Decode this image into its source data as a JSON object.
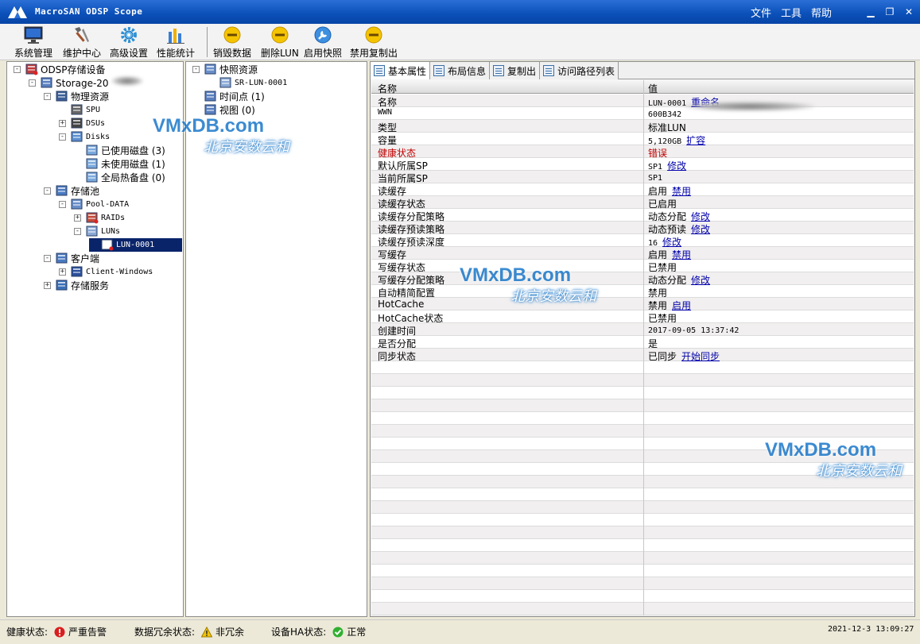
{
  "app": {
    "title": "MacroSAN ODSP Scope"
  },
  "menu": [
    "文件",
    "工具",
    "帮助"
  ],
  "window_buttons": {
    "minimize": "▁",
    "restore": "❐",
    "close": "✕"
  },
  "toolbar": [
    {
      "label": "系统管理",
      "icon": "monitor-icon"
    },
    {
      "label": "维护中心",
      "icon": "tools-icon"
    },
    {
      "label": "高级设置",
      "icon": "gear-icon"
    },
    {
      "label": "性能统计",
      "icon": "bar-chart-icon"
    },
    {
      "label": "销毁数据",
      "icon": "minus-circle-icon"
    },
    {
      "label": "删除LUN",
      "icon": "minus-circle-icon"
    },
    {
      "label": "启用快照",
      "icon": "wrench-icon"
    },
    {
      "label": "禁用复制出",
      "icon": "minus-circle-icon"
    }
  ],
  "tree": [
    {
      "label": "ODSP存储设备",
      "level": 0,
      "expander": "−",
      "icon": "storage-device-icon"
    },
    {
      "label": "Storage-20",
      "level": 1,
      "expander": "−",
      "icon": "storage-icon"
    },
    {
      "label": "物理资源",
      "level": 2,
      "expander": "−",
      "icon": "physical-resource-icon"
    },
    {
      "label": "SPU",
      "level": 3,
      "expander": "",
      "icon": "spu-icon",
      "mono": true
    },
    {
      "label": "DSUs",
      "level": 3,
      "expander": "+",
      "icon": "dsu-icon",
      "mono": true
    },
    {
      "label": "Disks",
      "level": 3,
      "expander": "−",
      "icon": "disks-icon",
      "mono": true
    },
    {
      "label": "已使用磁盘 (3)",
      "level": 4,
      "expander": "",
      "icon": "disk-icon"
    },
    {
      "label": "未使用磁盘 (1)",
      "level": 4,
      "expander": "",
      "icon": "disk-icon"
    },
    {
      "label": "全局热备盘 (0)",
      "level": 4,
      "expander": "",
      "icon": "disk-icon"
    },
    {
      "label": "存储池",
      "level": 2,
      "expander": "−",
      "icon": "pool-icon"
    },
    {
      "label": "Pool-DATA",
      "level": 3,
      "expander": "−",
      "icon": "pool-data-icon",
      "mono": true
    },
    {
      "label": "RAIDs",
      "level": 4,
      "expander": "+",
      "icon": "raid-icon",
      "mono": true
    },
    {
      "label": "LUNs",
      "level": 4,
      "expander": "−",
      "icon": "luns-icon",
      "mono": true
    },
    {
      "label": "LUN-0001",
      "level": 5,
      "expander": "",
      "icon": "lun-icon",
      "mono": true,
      "selected": true
    },
    {
      "label": "客户端",
      "level": 2,
      "expander": "−",
      "icon": "client-icon"
    },
    {
      "label": "Client-Windows",
      "level": 3,
      "expander": "+",
      "icon": "client-host-icon",
      "mono": true
    },
    {
      "label": "存储服务",
      "level": 2,
      "expander": "+",
      "icon": "service-icon"
    }
  ],
  "snap_tree": [
    {
      "label": "快照资源",
      "level": 0,
      "expander": "−",
      "icon": "snapshot-icon"
    },
    {
      "label": "SR-LUN-0001",
      "level": 1,
      "expander": "",
      "icon": "snapshot-resource-icon",
      "mono": true
    },
    {
      "label": "时间点 (1)",
      "level": 0,
      "expander": "",
      "icon": "timepoint-icon"
    },
    {
      "label": "视图 (0)",
      "level": 0,
      "expander": "",
      "icon": "view-icon"
    }
  ],
  "tabs": [
    "基本属性",
    "布局信息",
    "复制出",
    "访问路径列表"
  ],
  "grid": {
    "col_name": "名称",
    "col_value": "值",
    "rows": [
      {
        "name": "名称",
        "value": "LUN-0001",
        "link": "重命名"
      },
      {
        "name": "WWN",
        "value": "600B342",
        "link": "",
        "mono_name": true
      },
      {
        "name": "类型",
        "value": "标准LUN",
        "link": ""
      },
      {
        "name": "容量",
        "value": "5,120GB",
        "link": "扩容"
      },
      {
        "name": "健康状态",
        "value": "错误",
        "link": "",
        "red": true
      },
      {
        "name": "默认所属SP",
        "value": "SP1",
        "link": "修改"
      },
      {
        "name": "当前所属SP",
        "value": "SP1",
        "link": ""
      },
      {
        "name": "读缓存",
        "value": "启用",
        "link": "禁用"
      },
      {
        "name": "读缓存状态",
        "value": "已启用",
        "link": ""
      },
      {
        "name": "读缓存分配策略",
        "value": "动态分配",
        "link": "修改"
      },
      {
        "name": "读缓存预读策略",
        "value": "动态预读",
        "link": "修改"
      },
      {
        "name": "读缓存预读深度",
        "value": "16",
        "link": "修改"
      },
      {
        "name": "写缓存",
        "value": "启用",
        "link": "禁用"
      },
      {
        "name": "写缓存状态",
        "value": "已禁用",
        "link": ""
      },
      {
        "name": "写缓存分配策略",
        "value": "动态分配",
        "link": "修改"
      },
      {
        "name": "自动精简配置",
        "value": "禁用",
        "link": ""
      },
      {
        "name": "HotCache",
        "value": "禁用",
        "link": "启用"
      },
      {
        "name": "HotCache状态",
        "value": "已禁用",
        "link": ""
      },
      {
        "name": "创建时间",
        "value": "2017-09-05 13:37:42",
        "link": ""
      },
      {
        "name": "是否分配",
        "value": "是",
        "link": ""
      },
      {
        "name": "同步状态",
        "value": "已同步",
        "link": "开始同步"
      }
    ]
  },
  "status": {
    "health_label": "健康状态:",
    "health_value": "严重告警",
    "redundancy_label": "数据冗余状态:",
    "redundancy_value": "非冗余",
    "ha_label": "设备HA状态:",
    "ha_value": "正常",
    "datetime": "2021-12-3 13:09:27"
  },
  "watermark": {
    "site": "VMxDB.com",
    "company": "北京安数云和"
  },
  "colors": {
    "titlebar": "#0a4fb8",
    "selection": "#0a246a",
    "link": "#0000aa",
    "error": "#c00000"
  }
}
